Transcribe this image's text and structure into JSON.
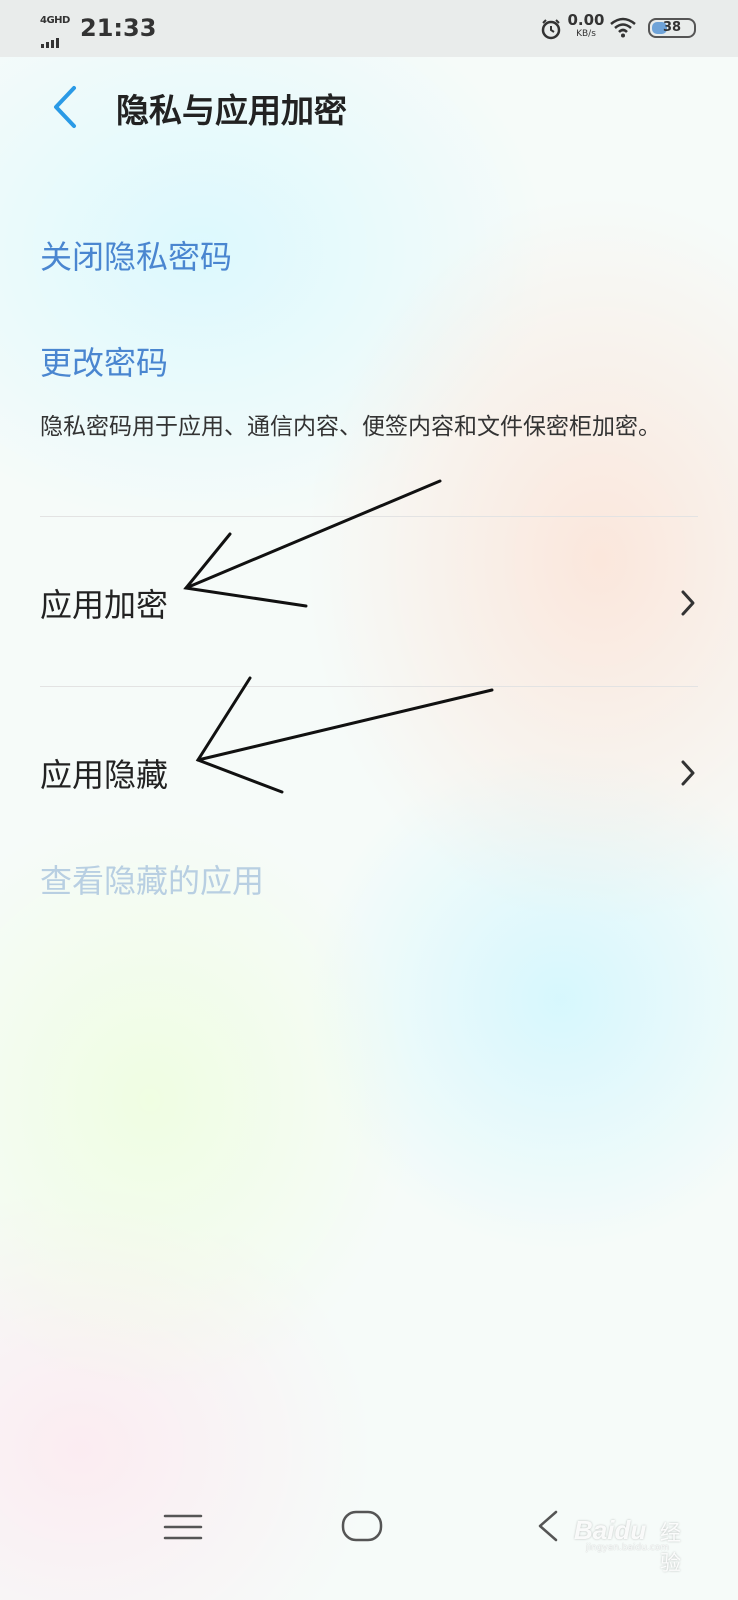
{
  "status_bar": {
    "network": "4GHD",
    "time": "21:33",
    "speed_value": "0.00",
    "speed_unit": "KB/s",
    "battery_level": "38",
    "battery_fraction": 0.38
  },
  "header": {
    "title": "隐私与应用加密"
  },
  "options": {
    "close_password": "关闭隐私密码",
    "change_password": "更改密码",
    "description": "隐私密码用于应用、通信内容、便签内容和文件保密柜加密。"
  },
  "menu": [
    {
      "label": "应用加密"
    },
    {
      "label": "应用隐藏"
    }
  ],
  "view_hidden": "查看隐藏的应用",
  "watermark": {
    "brand": "Baidu",
    "suffix": "经验",
    "url": "jingyan.baidu.com"
  },
  "colors": {
    "accent": "#4a86d0",
    "disabled": "#b8cfe2",
    "back_arrow": "#2a9ae6"
  }
}
